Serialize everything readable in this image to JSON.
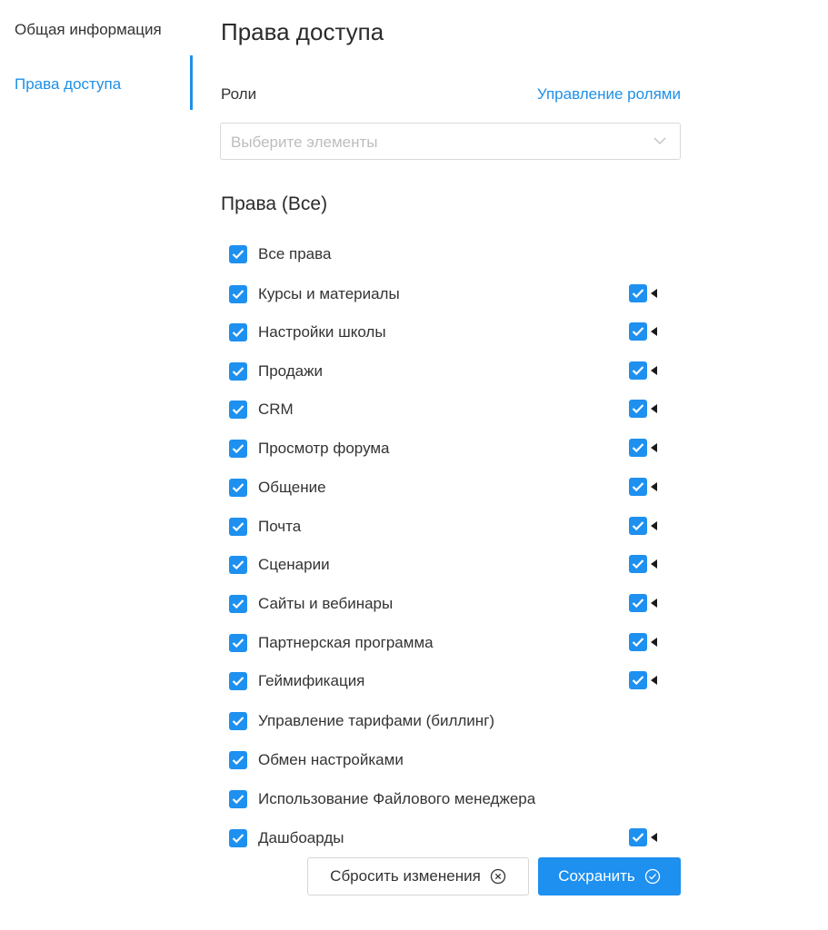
{
  "sidebar": {
    "items": [
      {
        "label": "Общая информация",
        "active": false
      },
      {
        "label": "Права доступа",
        "active": true
      }
    ]
  },
  "page": {
    "title": "Права доступа"
  },
  "roles": {
    "label": "Роли",
    "manage_link": "Управление ролями",
    "select_placeholder": "Выберите элементы"
  },
  "permissions": {
    "title": "Права (Все)",
    "items": [
      {
        "label": "Все права",
        "checked": true,
        "has_sub": false
      },
      {
        "label": "Курсы и материалы",
        "checked": true,
        "has_sub": true
      },
      {
        "label": "Настройки школы",
        "checked": true,
        "has_sub": true
      },
      {
        "label": "Продажи",
        "checked": true,
        "has_sub": true
      },
      {
        "label": "CRM",
        "checked": true,
        "has_sub": true
      },
      {
        "label": "Просмотр форума",
        "checked": true,
        "has_sub": true
      },
      {
        "label": "Общение",
        "checked": true,
        "has_sub": true
      },
      {
        "label": "Почта",
        "checked": true,
        "has_sub": true
      },
      {
        "label": "Сценарии",
        "checked": true,
        "has_sub": true
      },
      {
        "label": "Сайты и вебинары",
        "checked": true,
        "has_sub": true
      },
      {
        "label": "Партнерская программа",
        "checked": true,
        "has_sub": true
      },
      {
        "label": "Геймификация",
        "checked": true,
        "has_sub": true
      },
      {
        "label": "Управление тарифами (биллинг)",
        "checked": true,
        "has_sub": false
      },
      {
        "label": "Обмен настройками",
        "checked": true,
        "has_sub": false
      },
      {
        "label": "Использование Файлового менеджера",
        "checked": true,
        "has_sub": false
      },
      {
        "label": "Дашбоарды",
        "checked": true,
        "has_sub": true
      }
    ]
  },
  "actions": {
    "reset_label": "Сбросить изменения",
    "save_label": "Сохранить"
  },
  "colors": {
    "accent": "#1e90f0",
    "link": "#1e90e8"
  },
  "icons": {
    "reset": "close-circle-icon",
    "save": "check-circle-icon",
    "select": "chevron-down-icon",
    "expand": "caret-left-icon"
  }
}
